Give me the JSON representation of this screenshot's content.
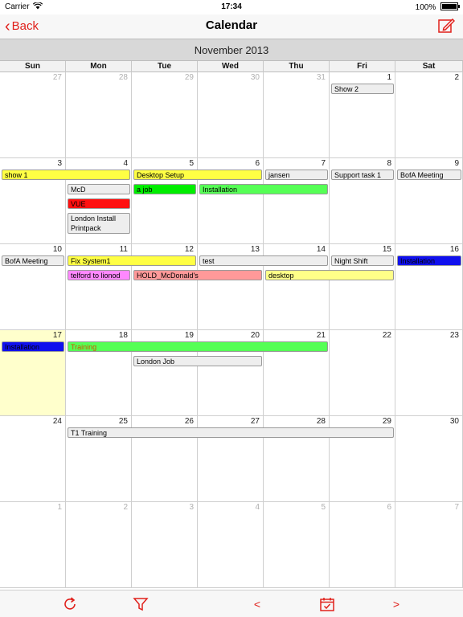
{
  "status": {
    "carrier": "Carrier",
    "wifi_icon": "wifi-icon",
    "time": "17:34",
    "battery": "100%",
    "battery_level": 1.0
  },
  "nav": {
    "back_label": "Back",
    "title": "Calendar",
    "compose_icon": "compose-icon"
  },
  "calendar": {
    "month_label": "November 2013",
    "weekdays": [
      "Sun",
      "Mon",
      "Tue",
      "Wed",
      "Thu",
      "Fri",
      "Sat"
    ],
    "weeks": [
      [
        {
          "d": "27",
          "out": true
        },
        {
          "d": "28",
          "out": true
        },
        {
          "d": "29",
          "out": true
        },
        {
          "d": "30",
          "out": true
        },
        {
          "d": "31",
          "out": true
        },
        {
          "d": "1"
        },
        {
          "d": "2"
        }
      ],
      [
        {
          "d": "3"
        },
        {
          "d": "4"
        },
        {
          "d": "5"
        },
        {
          "d": "6"
        },
        {
          "d": "7"
        },
        {
          "d": "8"
        },
        {
          "d": "9"
        }
      ],
      [
        {
          "d": "10"
        },
        {
          "d": "11"
        },
        {
          "d": "12"
        },
        {
          "d": "13"
        },
        {
          "d": "14"
        },
        {
          "d": "15"
        },
        {
          "d": "16"
        }
      ],
      [
        {
          "d": "17",
          "today": true
        },
        {
          "d": "18"
        },
        {
          "d": "19"
        },
        {
          "d": "20"
        },
        {
          "d": "21"
        },
        {
          "d": "22"
        },
        {
          "d": "23"
        }
      ],
      [
        {
          "d": "24"
        },
        {
          "d": "25"
        },
        {
          "d": "26"
        },
        {
          "d": "27"
        },
        {
          "d": "28"
        },
        {
          "d": "29"
        },
        {
          "d": "30"
        }
      ],
      [
        {
          "d": "1",
          "out": true
        },
        {
          "d": "2",
          "out": true
        },
        {
          "d": "3",
          "out": true
        },
        {
          "d": "4",
          "out": true
        },
        {
          "d": "5",
          "out": true
        },
        {
          "d": "6",
          "out": true
        },
        {
          "d": "7",
          "out": true
        }
      ]
    ],
    "events": [
      {
        "title": "Show 2",
        "week": 0,
        "start": 5,
        "span": 1,
        "lane": 0,
        "color": "#eeeeee"
      },
      {
        "title": "show 1",
        "week": 1,
        "start": 0,
        "span": 2,
        "lane": 0,
        "color": "#ffff44"
      },
      {
        "title": "Desktop Setup",
        "week": 1,
        "start": 2,
        "span": 2,
        "lane": 0,
        "color": "#ffff44"
      },
      {
        "title": "jansen",
        "week": 1,
        "start": 4,
        "span": 1,
        "lane": 0,
        "color": "#eeeeee"
      },
      {
        "title": "Support task 1",
        "week": 1,
        "start": 5,
        "span": 1,
        "lane": 0,
        "color": "#eeeeee"
      },
      {
        "title": "BofA Meeting",
        "week": 1,
        "start": 6,
        "span": 1,
        "lane": 0,
        "color": "#eeeeee"
      },
      {
        "title": "McD",
        "week": 1,
        "start": 1,
        "span": 1,
        "lane": 1,
        "color": "#eeeeee"
      },
      {
        "title": "a job",
        "week": 1,
        "start": 2,
        "span": 1,
        "lane": 1,
        "color": "#00ee00"
      },
      {
        "title": "Installation",
        "week": 1,
        "start": 3,
        "span": 2,
        "lane": 1,
        "color": "#55ff55"
      },
      {
        "title": "VUE",
        "week": 1,
        "start": 1,
        "span": 1,
        "lane": 2,
        "color": "#ff1010"
      },
      {
        "title": "London Install Printpack",
        "week": 1,
        "start": 1,
        "span": 1,
        "lane": 3,
        "color": "#eeeeee",
        "multi": true
      },
      {
        "title": "BofA Meeting",
        "week": 2,
        "start": 0,
        "span": 1,
        "lane": 0,
        "color": "#eeeeee"
      },
      {
        "title": "Fix System1",
        "week": 2,
        "start": 1,
        "span": 2,
        "lane": 0,
        "color": "#ffff44"
      },
      {
        "title": "test",
        "week": 2,
        "start": 3,
        "span": 2,
        "lane": 0,
        "color": "#eeeeee"
      },
      {
        "title": "Night Shift",
        "week": 2,
        "start": 5,
        "span": 1,
        "lane": 0,
        "color": "#eeeeee"
      },
      {
        "title": "Installation",
        "week": 2,
        "start": 6,
        "span": 1,
        "lane": 0,
        "color": "#1010ee"
      },
      {
        "title": "telford to lionod",
        "week": 2,
        "start": 1,
        "span": 1,
        "lane": 1,
        "color": "#ff88ff"
      },
      {
        "title": "HOLD_McDonald's",
        "week": 2,
        "start": 2,
        "span": 2,
        "lane": 1,
        "color": "#ff9999"
      },
      {
        "title": "desktop",
        "week": 2,
        "start": 4,
        "span": 2,
        "lane": 1,
        "color": "#ffff88"
      },
      {
        "title": "Installation",
        "week": 3,
        "start": 0,
        "span": 1,
        "lane": 0,
        "color": "#1010ee"
      },
      {
        "title": "Training",
        "week": 3,
        "start": 1,
        "span": 4,
        "lane": 0,
        "color": "#55ff55",
        "text": "#cc5500"
      },
      {
        "title": "London Job",
        "week": 3,
        "start": 2,
        "span": 2,
        "lane": 1,
        "color": "#eeeeee"
      },
      {
        "title": "T1 Training",
        "week": 4,
        "start": 1,
        "span": 5,
        "lane": 0,
        "color": "#eeeeee"
      }
    ]
  },
  "toolbar": {
    "refresh_icon": "refresh-icon",
    "filter_icon": "filter-icon",
    "prev_label": "<",
    "today_icon": "calendar-today-icon",
    "next_label": ">"
  }
}
